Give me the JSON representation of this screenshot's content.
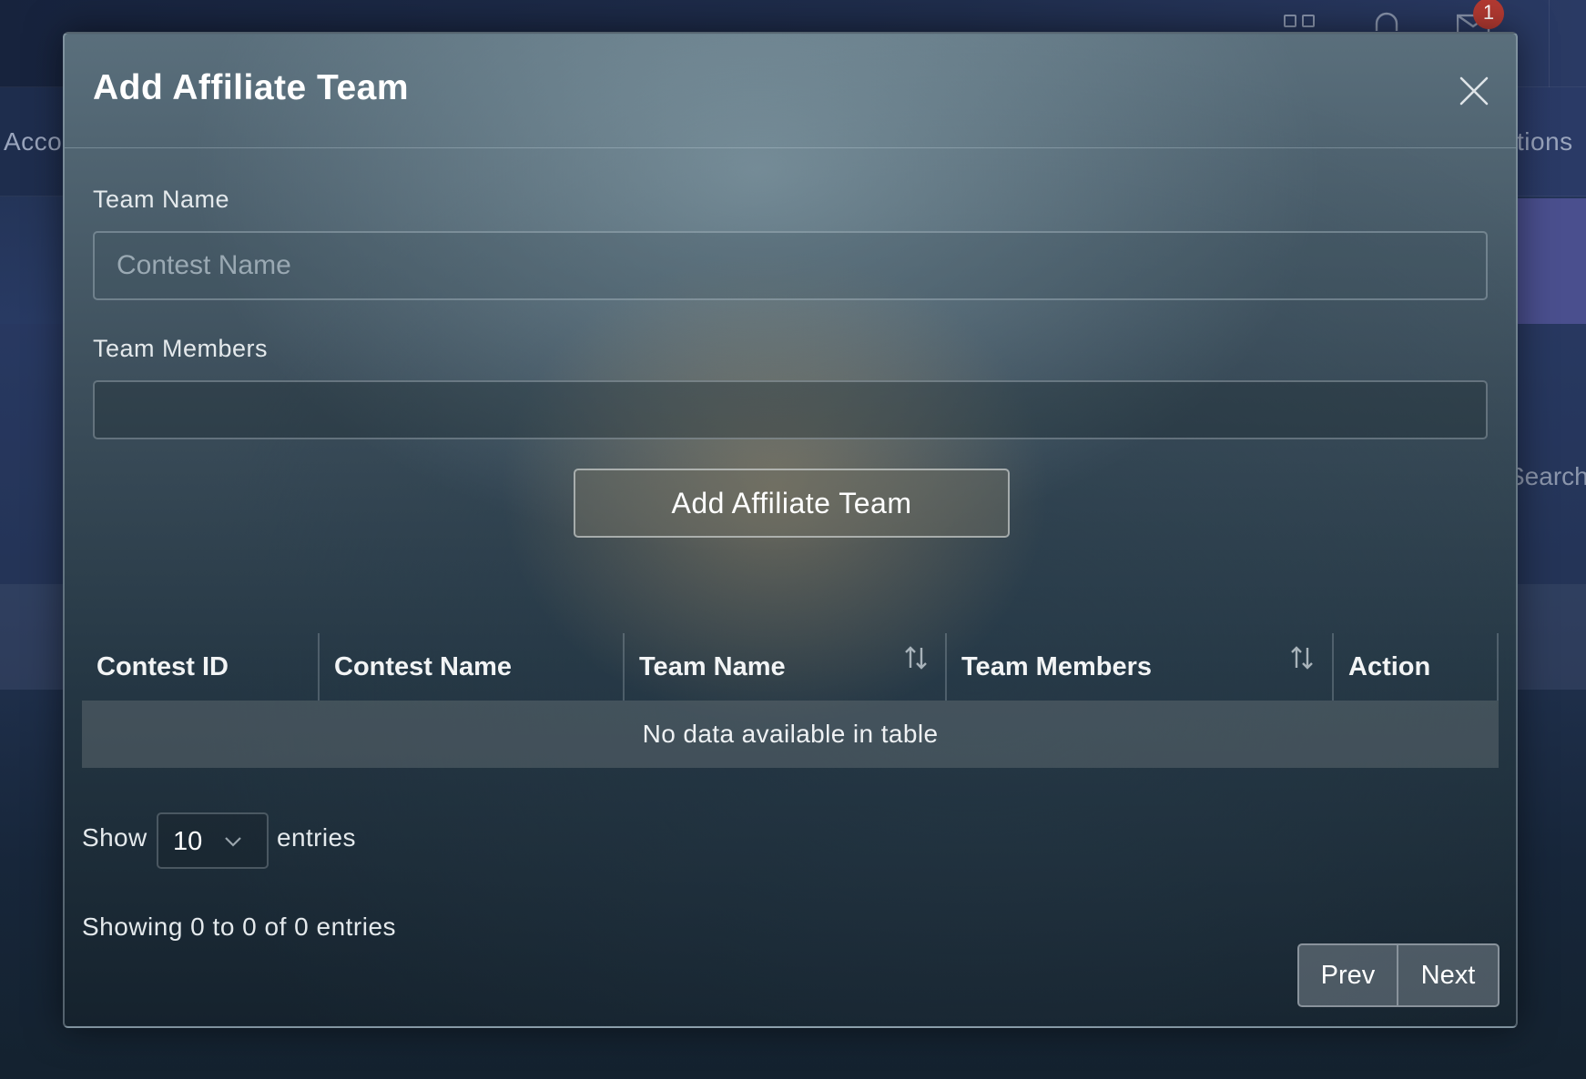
{
  "background": {
    "nav_left_text": "Acco",
    "nav_right_text": "tions",
    "search_text": "Search",
    "notification_count": "1"
  },
  "modal": {
    "title": "Add Affiliate Team",
    "close_icon": "close-icon"
  },
  "form": {
    "team_name_label": "Team Name",
    "team_name_placeholder": "Contest Name",
    "team_name_value": "",
    "team_members_label": "Team Members",
    "team_members_value": "",
    "submit_label": "Add Affiliate Team"
  },
  "table": {
    "columns": [
      {
        "label": "Contest ID",
        "sortable": false
      },
      {
        "label": "Contest Name",
        "sortable": false
      },
      {
        "label": "Team Name",
        "sortable": true
      },
      {
        "label": "Team Members",
        "sortable": true
      },
      {
        "label": "Action",
        "sortable": false
      }
    ],
    "empty_message": "No data available in table"
  },
  "length": {
    "show_label": "Show",
    "selected": "10",
    "entries_label": "entries"
  },
  "info": "Showing 0 to 0 of 0 entries",
  "pagination": {
    "prev_label": "Prev",
    "next_label": "Next"
  }
}
